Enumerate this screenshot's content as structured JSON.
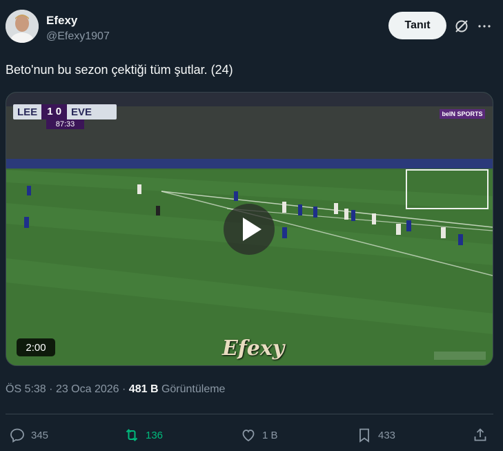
{
  "author": {
    "name": "Efexy",
    "handle": "@Efexy1907"
  },
  "header": {
    "follow_label": "Tanıt"
  },
  "tweet": {
    "text": "Beto'nun bu sezon çektiği tüm şutlar. (24)"
  },
  "media": {
    "duration": "2:00",
    "watermark": "Efexy",
    "scoreboard": {
      "home": "LEE",
      "score": "1 0",
      "away": "EVE",
      "clock": "87:33"
    },
    "broadcaster": "beIN SPORTS"
  },
  "meta": {
    "time": "ÖS 5:38",
    "date": "23 Oca 2026",
    "views_count": "481 B",
    "views_label": "Görüntüleme"
  },
  "actions": {
    "replies": "345",
    "retweets": "136",
    "likes": "1 B",
    "bookmarks": "433"
  },
  "icons": [
    "reply-icon",
    "retweet-icon",
    "like-icon",
    "bookmark-icon",
    "share-icon",
    "grok-icon",
    "more-icon",
    "play-icon"
  ],
  "colors": {
    "background": "#15202b",
    "retweet_active": "#00ba7c",
    "muted": "#8b98a5"
  }
}
